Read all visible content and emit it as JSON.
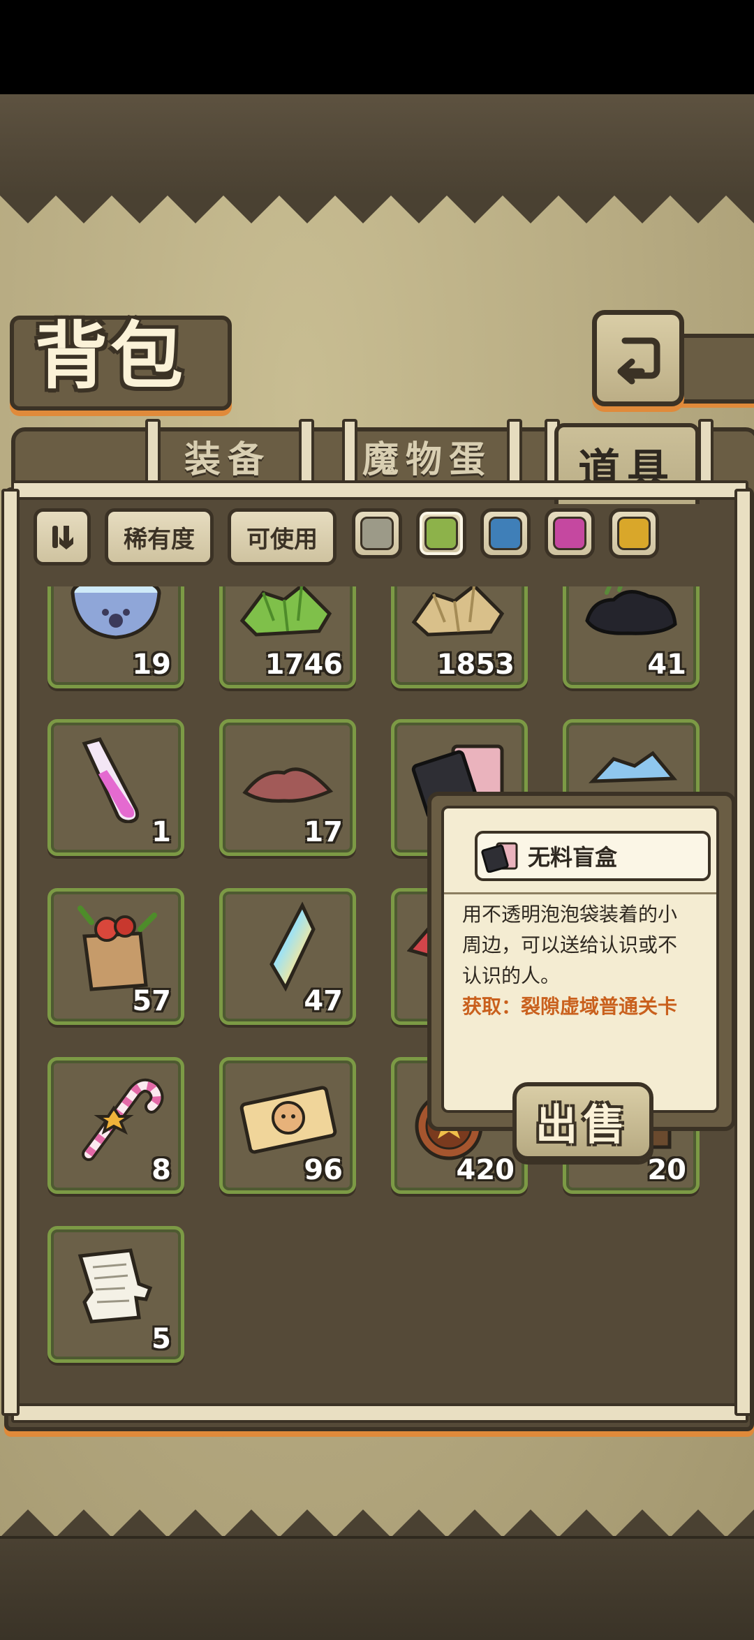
{
  "page": {
    "title": "背包"
  },
  "tabs": [
    {
      "label": "装备",
      "active": false
    },
    {
      "label": "魔物蛋",
      "active": false
    },
    {
      "label": "道具",
      "active": true
    }
  ],
  "filters": {
    "sort_icon": "sort-toggle-icon",
    "rarity_label": "稀有度",
    "usable_label": "可使用",
    "colors": [
      {
        "name": "gray",
        "hex": "#9c9a88",
        "selected": false
      },
      {
        "name": "green",
        "hex": "#8db24a",
        "selected": true
      },
      {
        "name": "blue",
        "hex": "#3f7fb8",
        "selected": false
      },
      {
        "name": "purple",
        "hex": "#c548a0",
        "selected": false
      },
      {
        "name": "gold",
        "hex": "#d9a72a",
        "selected": false
      }
    ]
  },
  "items": [
    {
      "icon": "pet-bowl-icon",
      "count": "19"
    },
    {
      "icon": "green-crystals-icon",
      "count": "1746"
    },
    {
      "icon": "tan-crystals-icon",
      "count": "1853"
    },
    {
      "icon": "dark-ore-icon",
      "count": "41"
    },
    {
      "icon": "pink-potion-tube-icon",
      "count": "1"
    },
    {
      "icon": "red-dust-pile-icon",
      "count": "17"
    },
    {
      "icon": "blind-box-icon",
      "count": ""
    },
    {
      "icon": "blue-crystals-icon",
      "count": ""
    },
    {
      "icon": "grocery-bag-icon",
      "count": "57"
    },
    {
      "icon": "rainbow-crystal-shard-icon",
      "count": "47"
    },
    {
      "icon": "red-gem-icon",
      "count": ""
    },
    {
      "icon": "hidden-item-icon",
      "count": ""
    },
    {
      "icon": "candy-cane-icon",
      "count": "8"
    },
    {
      "icon": "dog-ticket-icon",
      "count": "96"
    },
    {
      "icon": "medal-coin-icon",
      "count": "420"
    },
    {
      "icon": "wood-crate-icon",
      "count": "20"
    },
    {
      "icon": "paper-scrap-icon",
      "count": "5"
    }
  ],
  "tooltip": {
    "name": "无料盲盒",
    "desc_line1": "用不透明泡泡袋装着的小",
    "desc_line2": "周边，可以送给认识或不",
    "desc_line3": "认识的人。",
    "source": "获取：裂隙虚域普通关卡",
    "sell_label": "出售"
  }
}
